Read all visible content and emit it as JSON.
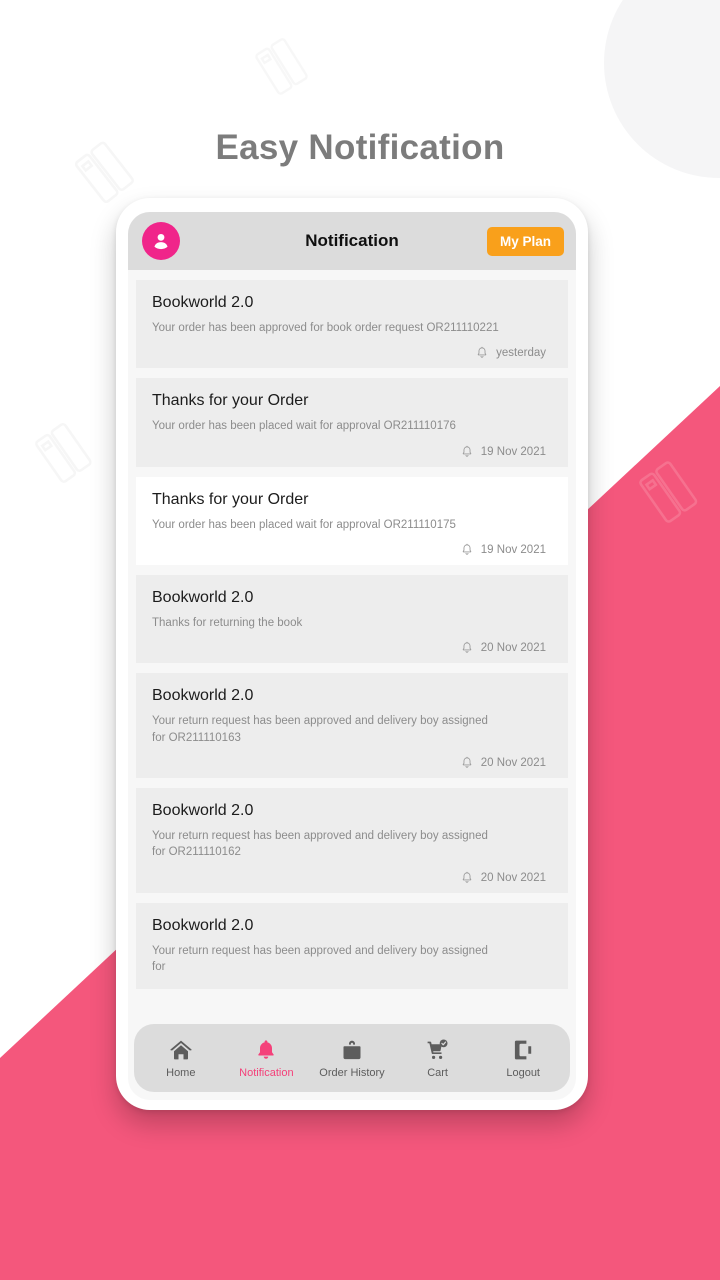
{
  "page": {
    "headline": "Easy Notification",
    "colors": {
      "pink": "#f4577c",
      "accent_pink": "#f0258a",
      "active_nav_pink": "#f4417a",
      "orange": "#f9a01b",
      "appbar_gray": "#dcdcdc",
      "card_gray": "#ededed",
      "screen_gray": "#f7f7f7",
      "headline_gray": "#7c7c7c"
    }
  },
  "appbar": {
    "title": "Notification",
    "avatar_icon": "user-avatar-icon",
    "plan_button": "My Plan"
  },
  "notifications": [
    {
      "title": "Bookworld 2.0",
      "body": "Your order has been approved for book order request OR211110221",
      "time": "yesterday",
      "icon": "bell-icon",
      "style": "gray"
    },
    {
      "title": "Thanks for your Order",
      "body": "Your order has been placed wait for approval OR211110176",
      "time": "19 Nov 2021",
      "icon": "bell-icon",
      "style": "gray"
    },
    {
      "title": "Thanks for your Order",
      "body": "Your order has been placed wait for approval OR211110175",
      "time": "19 Nov 2021",
      "icon": "bell-icon",
      "style": "light"
    },
    {
      "title": "Bookworld 2.0",
      "body": "Thanks for returning the book",
      "time": "20 Nov 2021",
      "icon": "bell-icon",
      "style": "gray"
    },
    {
      "title": "Bookworld 2.0",
      "body": "Your return request has been approved and delivery boy assigned for OR211110163",
      "time": "20 Nov 2021",
      "icon": "bell-icon",
      "style": "gray"
    },
    {
      "title": "Bookworld 2.0",
      "body": "Your return request has been approved and delivery boy assigned for OR211110162",
      "time": "20 Nov 2021",
      "icon": "bell-icon",
      "style": "gray"
    },
    {
      "title": "Bookworld 2.0",
      "body": "Your return request has been approved and delivery boy assigned for",
      "time": "",
      "icon": "bell-icon",
      "style": "gray"
    }
  ],
  "bottom_nav": {
    "items": [
      {
        "label": "Home",
        "icon": "home-icon",
        "active": false
      },
      {
        "label": "Notification",
        "icon": "bell-icon",
        "active": true
      },
      {
        "label": "Order History",
        "icon": "shopping-bag-icon",
        "active": false
      },
      {
        "label": "Cart",
        "icon": "shopping-cart-check-icon",
        "active": false
      },
      {
        "label": "Logout",
        "icon": "logout-icon",
        "active": false
      }
    ]
  }
}
